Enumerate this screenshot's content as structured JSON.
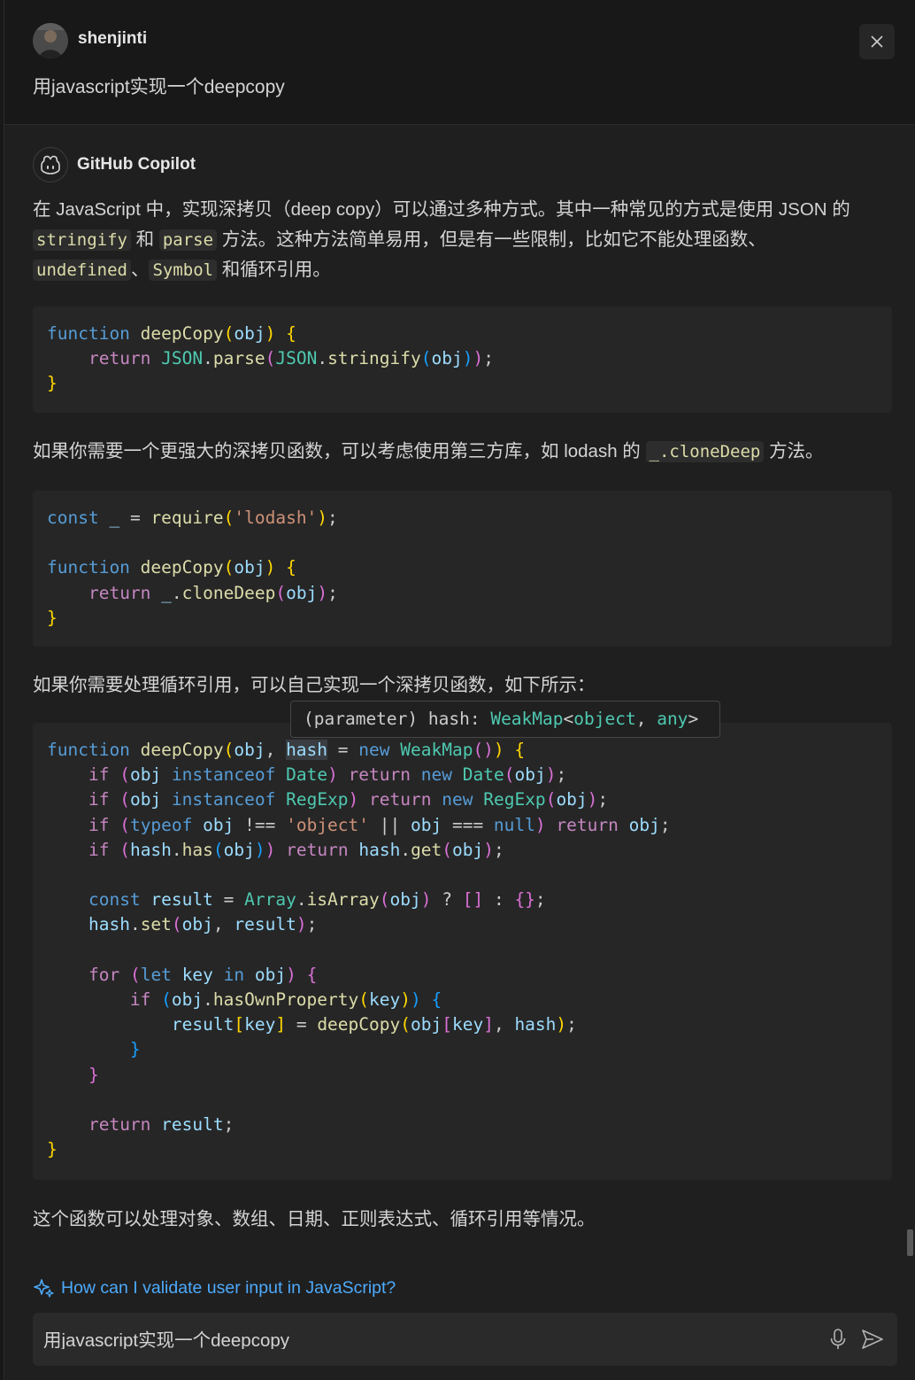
{
  "user": {
    "name": "shenjinti",
    "message": "用javascript实现一个deepcopy"
  },
  "bot": {
    "name": "GitHub Copilot"
  },
  "response": {
    "p1": {
      "a": "在 JavaScript 中，实现深拷贝（deep copy）可以通过多种方式。其中一种常见的方式是使用 JSON 的",
      "code1": "stringify",
      "b": "和",
      "code2": "parse",
      "c": "方法。这种方法简单易用，但是有一些限制，比如它不能处理函数、",
      "code3": "undefined",
      "d": "、",
      "code4": "Symbol",
      "e": "和循环引用。"
    },
    "p2": {
      "a": "如果你需要一个更强大的深拷贝函数，可以考虑使用第三方库，如 lodash 的",
      "code": "_.cloneDeep",
      "b": "方法。"
    },
    "p3": "如果你需要处理循环引用，可以自己实现一个深拷贝函数，如下所示：",
    "p4": "这个函数可以处理对象、数组、日期、正则表达式、循环引用等情况。"
  },
  "tooltip": {
    "prefix": "(parameter) hash: ",
    "type": "WeakMap",
    "lt": "<",
    "arg1": "object",
    "comma": ", ",
    "arg2": "any",
    "gt": ">"
  },
  "followup": "How can I validate user input in JavaScript?",
  "input": {
    "value": "用javascript实现一个deepcopy"
  },
  "icons": {
    "close": "close-icon",
    "copilot": "copilot-icon",
    "sparkle": "sparkle-icon",
    "mic": "mic-icon",
    "send": "send-icon"
  }
}
